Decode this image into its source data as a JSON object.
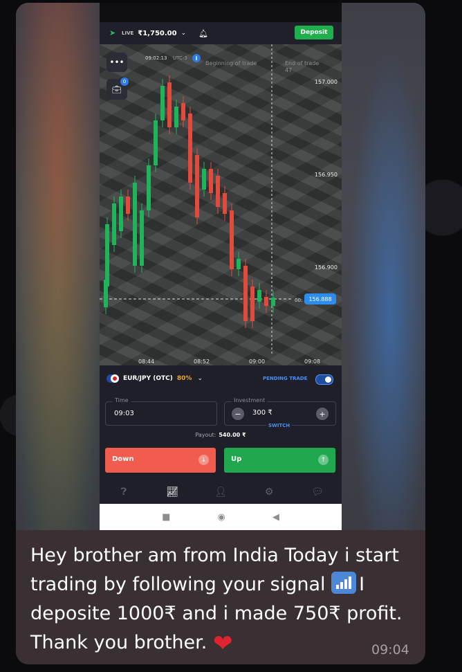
{
  "app": {
    "top_bar": {
      "live_label": "LIVE",
      "balance": "₹1,750.00",
      "deposit_label": "Deposit"
    },
    "chart": {
      "timer": "09:02:13",
      "timezone": "UTC-3",
      "beginning_label": "Beginning of trade",
      "end_label": "End of trade",
      "end_sub": "47",
      "case_badge": "0",
      "y_ticks": [
        "157.000",
        "156.950",
        "156.900"
      ],
      "x_ticks": [
        "08:44",
        "08:52",
        "09:00",
        "09:08"
      ],
      "current_prefix": "00:",
      "current_price": "156.888"
    },
    "trade_panel": {
      "pair": "EUR/JPY (OTC)",
      "payout_pct": "80%",
      "pending_label": "PENDING TRADE",
      "time_label": "Time",
      "time_value": "09:03",
      "investment_label": "Investment",
      "investment_value": "300 ₹",
      "switch_label": "SWITCH",
      "payout_label": "Payout:",
      "payout_value": "540.00 ₹",
      "down_label": "Down",
      "up_label": "Up"
    }
  },
  "message": {
    "text_part1": "Hey brother am from India Today i start trading by following your signal",
    "text_part2": "I deposite 1000₹ and i made 750₹ profit. Thank you brother.",
    "time": "09:04"
  },
  "colors": {
    "bubble": "#3a2f33",
    "deposit_green": "#1fb04e",
    "down_red": "#f25c4e",
    "up_green": "#1fa84e",
    "accent_blue": "#2d8cf0"
  },
  "icons": [
    "send-icon",
    "chevron-down-icon",
    "bell-icon",
    "menu-dots-icon",
    "briefcase-icon",
    "info-icon",
    "minus-icon",
    "plus-icon",
    "arrow-down-icon",
    "arrow-up-icon",
    "help-icon",
    "chart-icon",
    "user-icon",
    "settings-icon",
    "chat-icon",
    "signal-bars-icon",
    "heart-icon"
  ]
}
